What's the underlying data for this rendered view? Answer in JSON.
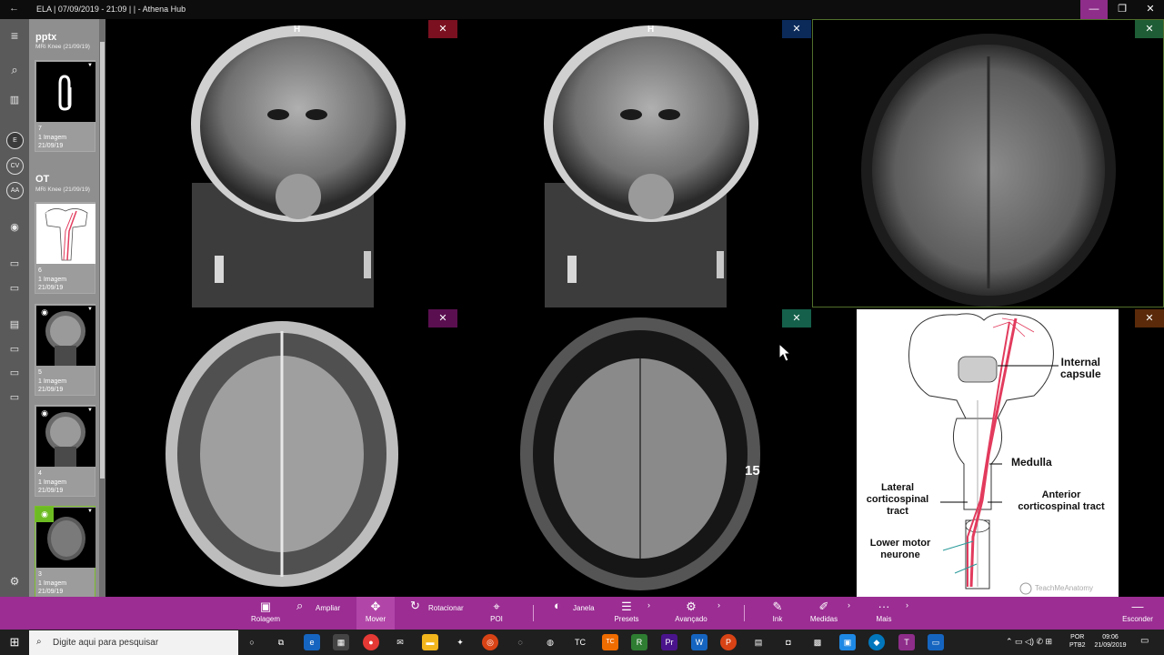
{
  "window": {
    "title": "ELA | 07/09/2019 - 21:09 | | - Athena Hub",
    "back_icon": "back-arrow-icon",
    "min_label": "—",
    "max_label": "❐",
    "close_label": "✕"
  },
  "rail": {
    "items": [
      "≡",
      "⌕",
      "▥",
      "E",
      "CV",
      "AA",
      "◉",
      "▭",
      "▭",
      "▤",
      "▭",
      "▭",
      "▭",
      "⚙"
    ]
  },
  "panel": {
    "groups": [
      {
        "title": "pptx",
        "subtitle": "MRi Knee (21/09/19)",
        "items": [
          {
            "number": "7",
            "count": "1 Imagem",
            "date": "21/09/19",
            "kind": "attachment"
          }
        ]
      },
      {
        "title": "OT",
        "subtitle": "MRi Knee (21/09/19)",
        "items": [
          {
            "number": "6",
            "count": "1 Imagem",
            "date": "21/09/19",
            "kind": "diagram"
          },
          {
            "number": "5",
            "count": "1 Imagem",
            "date": "21/09/19",
            "kind": "mri"
          },
          {
            "number": "4",
            "count": "1 Imagem",
            "date": "21/09/19",
            "kind": "mri"
          },
          {
            "number": "3",
            "count": "1 Imagem",
            "date": "21/09/19",
            "kind": "mri-axial",
            "selected": true
          }
        ]
      }
    ]
  },
  "viewports": {
    "close_label": "✕",
    "close_colors": [
      "#7a1020",
      "#0b2a5a",
      "#1e5d36",
      "#5a0f50",
      "#15604a",
      "#5a2a0a"
    ],
    "top_marker": "H",
    "slice_number": "15"
  },
  "anatomy": {
    "labels": {
      "internal_capsule": [
        "Internal",
        "capsule"
      ],
      "medulla": "Medulla",
      "lateral": [
        "Lateral",
        "corticospinal",
        "tract"
      ],
      "anterior": [
        "Anterior",
        "corticospinal tract"
      ],
      "lower_motor": [
        "Lower motor",
        "neurone"
      ],
      "watermark": "TeachMeAnatomy"
    },
    "tract_color": "#e23b5d"
  },
  "toolbar": {
    "tools": [
      {
        "label": "Rolagem",
        "icon": "▣"
      },
      {
        "label": "Ampliar",
        "icon": "⌕"
      },
      {
        "label": "Mover",
        "icon": "✥"
      },
      {
        "label": "Rotacionar",
        "icon": "↻"
      },
      {
        "label": "POI",
        "icon": "⌖"
      },
      {
        "label": "Janela",
        "icon": "◐"
      },
      {
        "label": "Presets",
        "icon": "☰"
      },
      {
        "label": "Avançado",
        "icon": "⚙"
      },
      {
        "label": "Ink",
        "icon": "✎"
      },
      {
        "label": "Medidas",
        "icon": "✐"
      },
      {
        "label": "Mais",
        "icon": "···"
      },
      {
        "label": "Esconder",
        "icon": "—"
      }
    ],
    "chevron": "›"
  },
  "taskbar": {
    "search_placeholder": "Digite aqui para pesquisar",
    "lang": [
      "POR",
      "PTB2"
    ],
    "time": "09:06",
    "date": "21/09/2019",
    "apps": [
      "○",
      "⧉",
      "e",
      "▦",
      "●",
      "✉",
      "▬",
      "✦",
      "◎",
      "◌",
      "◍",
      "TC",
      "R",
      "Pr",
      "W",
      "P",
      "▤",
      "◘",
      "▩",
      "▣",
      "◆",
      "T",
      "▭"
    ],
    "tray": "⌃ ▭ ◁) ✆ ⊞"
  }
}
